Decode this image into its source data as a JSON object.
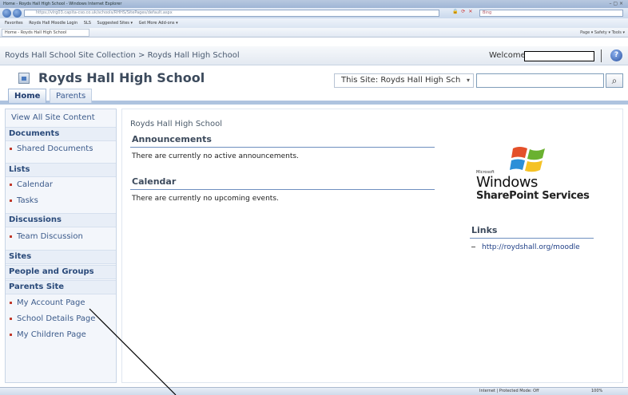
{
  "browser": {
    "window_title": "Home - Royds Hall High School - Windows Internet Explorer",
    "window_controls": "– ▢ ×",
    "url": "https://vlrg03.capita-cso.co.uk/schools/RHHS/SitePages/default.aspx",
    "search_placeholder": "Bing",
    "favorites_bar": [
      "Favorites",
      "Royds Hall Moodle Login",
      "SLS",
      "Suggested Sites ▾",
      "Get More Add-ons ▾"
    ],
    "tab_label": "Home - Royds Hall High School",
    "command_bar": "Page ▾  Safety ▾  Tools ▾",
    "status_zone": "Internet | Protected Mode: Off",
    "status_zoom": "100%"
  },
  "global": {
    "breadcrumb": "Royds Hall School Site Collection > Royds Hall High School",
    "welcome": "Welcome",
    "help_icon": "?"
  },
  "header": {
    "site_title": "Royds Hall High School",
    "search_scope": "This Site: Royds Hall High Sch",
    "search_value": "",
    "search_button_icon": "magnifier-icon"
  },
  "topnav": {
    "tabs": [
      {
        "label": "Home",
        "selected": true
      },
      {
        "label": "Parents",
        "selected": false
      }
    ]
  },
  "quicklaunch": {
    "view_all": "View All Site Content",
    "documents": "Documents",
    "shared_documents": "Shared Documents",
    "lists": "Lists",
    "calendar": "Calendar",
    "tasks": "Tasks",
    "discussions": "Discussions",
    "team_discussion": "Team Discussion",
    "sites": "Sites",
    "people_groups": "People and Groups",
    "parents_site": "Parents Site",
    "my_account": "My Account Page",
    "school_details": "School Details Page",
    "my_children": "My Children Page"
  },
  "main": {
    "page_title": "Royds Hall High School",
    "announcements_title": "Announcements",
    "announcements_empty": "There are currently no active announcements.",
    "calendar_title": "Calendar",
    "calendar_empty": "There are currently no upcoming events.",
    "logo_microsoft": "Microsoft",
    "logo_windows": "Windows",
    "logo_sharepoint": "SharePoint Services",
    "links_title": "Links",
    "links_item": "http://roydshall.org/moodle"
  },
  "colors": {
    "accent_blue": "#aec3df",
    "link_blue": "#1f3f86",
    "bullet_red": "#c0392b"
  }
}
